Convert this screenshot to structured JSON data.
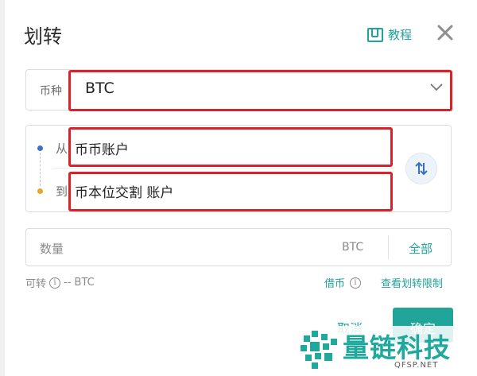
{
  "dialog": {
    "title": "划转",
    "tutorial_label": "教程"
  },
  "coin": {
    "label": "币种",
    "value": "BTC"
  },
  "route": {
    "from_label": "从",
    "from_account": "币币账户",
    "to_label": "到",
    "to_account": "币本位交割 账户"
  },
  "amount": {
    "placeholder": "数量",
    "unit": "BTC",
    "all_label": "全部"
  },
  "footer": {
    "available_label": "可转",
    "available_value": "-- BTC",
    "borrow_label": "借币",
    "limits_label": "查看划转限制"
  },
  "actions": {
    "cancel_label": "取消",
    "confirm_label": "确定"
  },
  "watermark": {
    "name": "量链科技",
    "site": "QFSP.NET"
  },
  "colors": {
    "accent": "#21a59a",
    "highlight": "#d8232a",
    "from_dot": "#3f6fd1",
    "to_dot": "#e9a72a"
  }
}
